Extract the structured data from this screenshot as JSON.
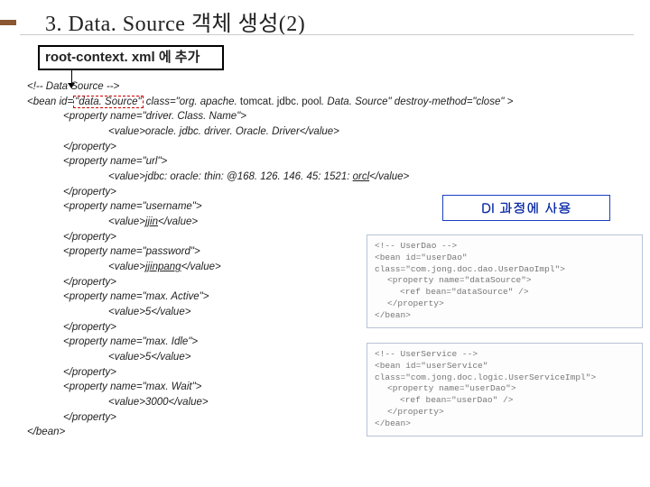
{
  "title": "3. Data. Source 객체 생성(2)",
  "root_label": "root-context. xml 에 추가",
  "callout": "DI 과정에  사용",
  "code": {
    "c0": "<!-- Data Source -->",
    "bean_open_a": "<bean id=",
    "bean_id": "\"data. Source\"",
    "bean_open_b": " class=\"org. apache. ",
    "tomcat": "tomcat. jdbc. pool",
    "bean_open_c": ". Data. Source\" destroy-method=\"close\" >",
    "p1": "<property name=\"driver. Class. Name\">",
    "v1": "<value>oracle. jdbc. driver. Oracle. Driver</value>",
    "pe": "</property>",
    "p2": "<property name=\"url\">",
    "v2a": "<value>jdbc: oracle: thin: @168. 126. 146. 45: 1521: ",
    "v2b": "orcl",
    "v2c": "</value>",
    "p3": "<property name=\"username\">",
    "v3a": "<value>",
    "v3b": "jjin",
    "v3c": "</value>",
    "p4": "<property name=\"password\">",
    "v4a": "<value>",
    "v4b": "jjinpang",
    "v4c": "</value>",
    "p5": "<property name=\"max. Active\">",
    "v5": "<value>5</value>",
    "p6": "<property name=\"max. Idle\">",
    "v6": "<value>5</value>",
    "p7": "<property name=\"max. Wait\">",
    "v7": "<value>3000</value>",
    "bean_close": "</bean>"
  },
  "snippet_a": {
    "l0": "<!-- UserDao -->",
    "l1": "<bean id=\"userDao\" class=\"com.jong.doc.dao.UserDaoImpl\">",
    "l2": "<property name=\"dataSource\">",
    "l3": "<ref bean=\"dataSource\" />",
    "l4": "</property>",
    "l5": "</bean>"
  },
  "snippet_b": {
    "l0": "<!-- UserService -->",
    "l1": "<bean id=\"userService\" class=\"com.jong.doc.logic.UserServiceImpl\">",
    "l2": "<property name=\"userDao\">",
    "l3": "<ref bean=\"userDao\" />",
    "l4": "</property>",
    "l5": "</bean>"
  }
}
